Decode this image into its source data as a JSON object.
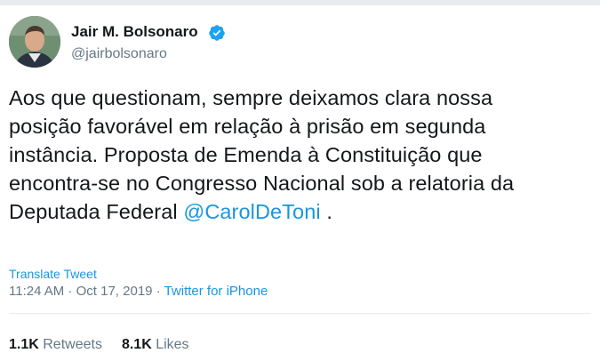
{
  "author": {
    "display_name": "Jair M. Bolsonaro",
    "handle": "@jairbolsonaro",
    "verified": true,
    "verified_color": "#1da1f2"
  },
  "tweet": {
    "lines": [
      "Aos que questionam, sempre deixamos clara nossa",
      "posição favorável em relação à prisão em segunda",
      "instância. Proposta de Emenda à Constituição que",
      "encontra-se no Congresso Nacional sob a relatoria da"
    ],
    "last_line_prefix": "Deputada Federal ",
    "mention": "@CarolDeToni",
    "last_line_suffix": " ."
  },
  "translate_label": "Translate Tweet",
  "meta": {
    "time": "11:24 AM",
    "separator1": " · ",
    "date": "Oct 17, 2019",
    "separator2": " · ",
    "source": "Twitter for iPhone"
  },
  "stats": {
    "retweets_count": "1.1K",
    "retweets_label": "Retweets",
    "likes_count": "8.1K",
    "likes_label": "Likes"
  },
  "colors": {
    "link": "#1b95e0",
    "secondary_text": "#657786",
    "primary_text": "#14171a"
  }
}
